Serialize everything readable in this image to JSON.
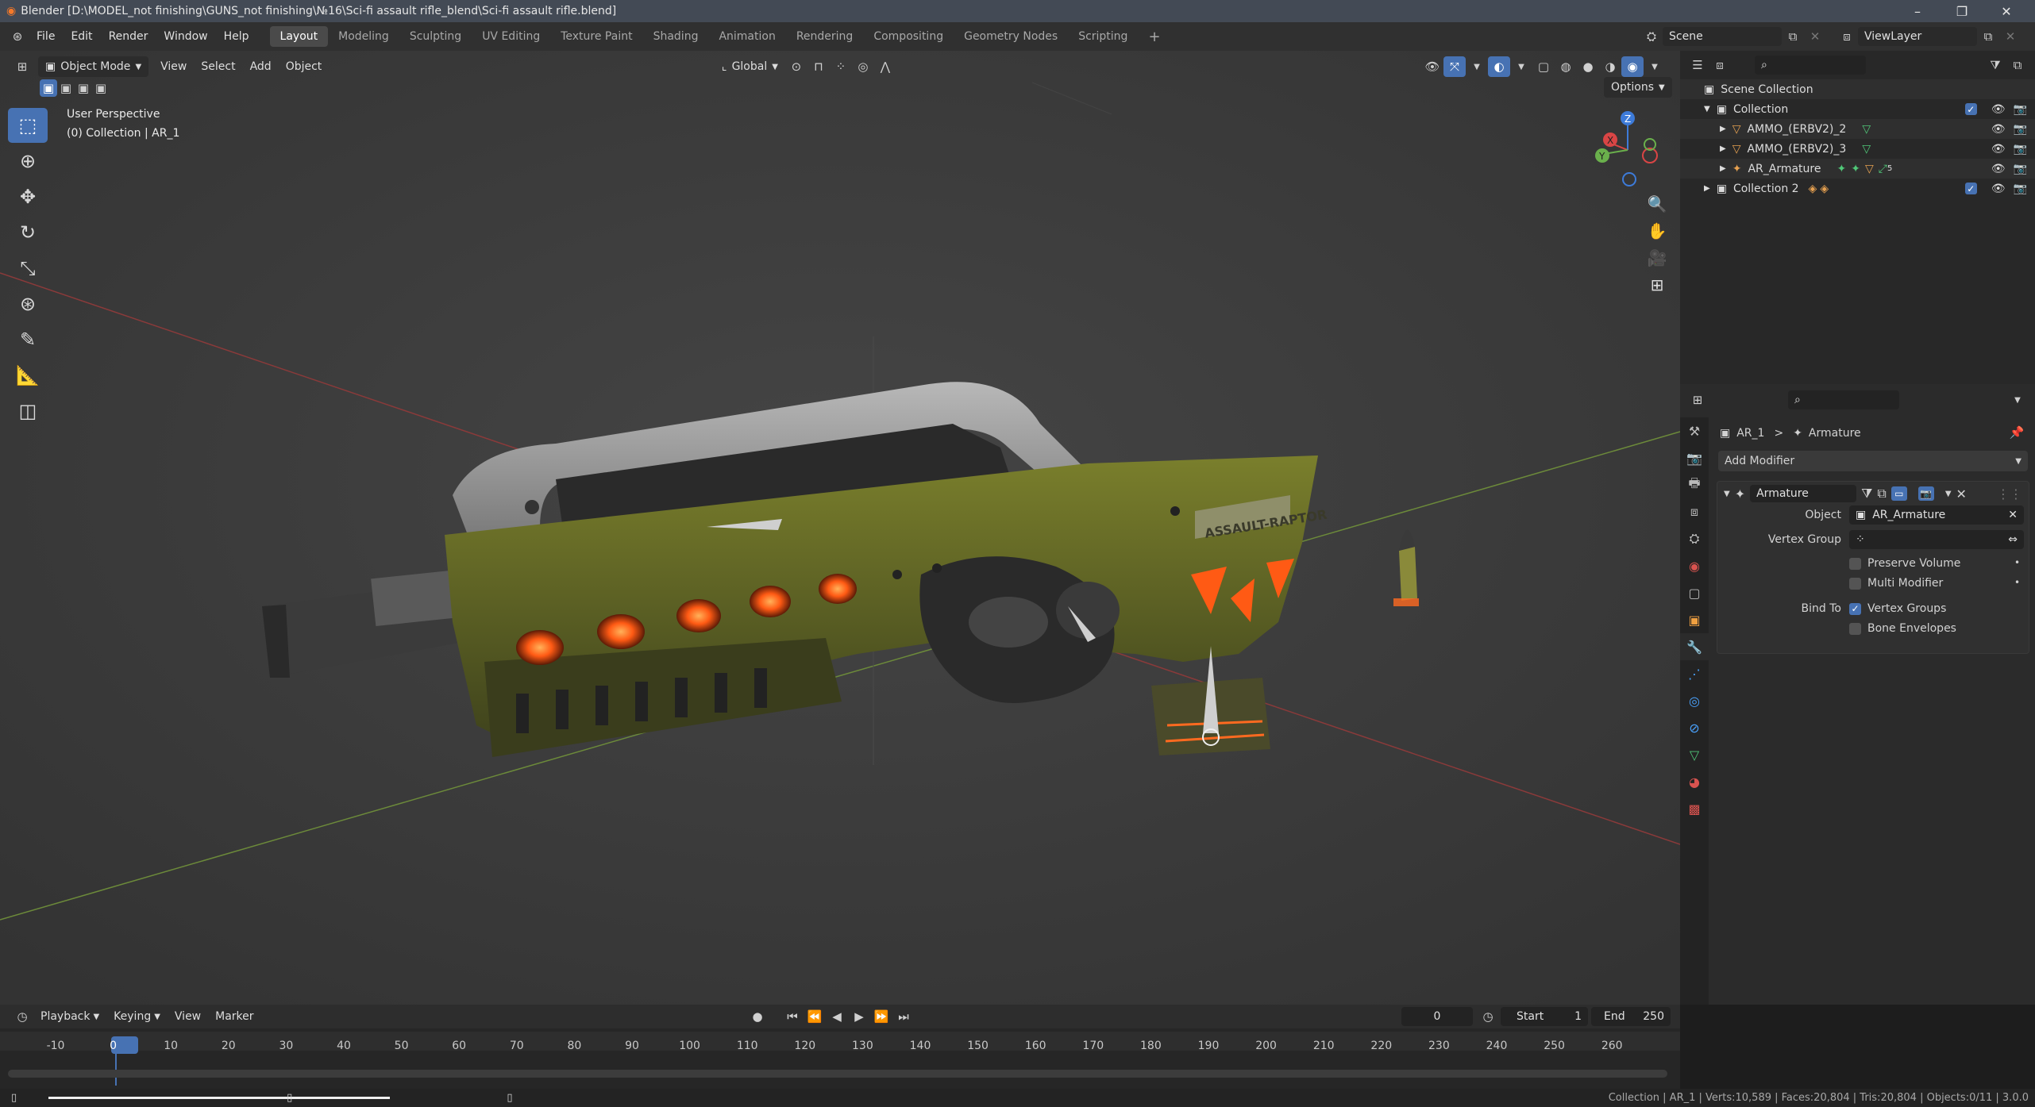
{
  "titlebar": {
    "title": "Blender [D:\\MODEL_not finishing\\GUNS_not finishing\\№16\\Sci-fi assault rifle_blend\\Sci-fi assault rifle.blend]",
    "minimize": "–",
    "maximize": "❐",
    "close": "✕"
  },
  "menubar": {
    "items": [
      "File",
      "Edit",
      "Render",
      "Window",
      "Help"
    ],
    "workspaces": [
      "Layout",
      "Modeling",
      "Sculpting",
      "UV Editing",
      "Texture Paint",
      "Shading",
      "Animation",
      "Rendering",
      "Compositing",
      "Geometry Nodes",
      "Scripting"
    ],
    "add_workspace": "+",
    "scene": "Scene",
    "view_layer": "ViewLayer"
  },
  "viewport": {
    "mode": "Object Mode",
    "menus": [
      "View",
      "Select",
      "Add",
      "Object"
    ],
    "transform_orientation": "Global",
    "options": "Options",
    "overlay_line1": "User Perspective",
    "overlay_line2": "(0) Collection | AR_1",
    "gizmo": {
      "x": "X",
      "y": "Y",
      "z": "Z"
    },
    "weapon_label": "ASSAULT-RAPTOR"
  },
  "outliner": {
    "search_placeholder": "",
    "root": "Scene Collection",
    "collection": "Collection",
    "children": [
      "AMMO_(ERBV2)_2",
      "AMMO_(ERBV2)_3",
      "AR_Armature"
    ],
    "armature_badge": "5",
    "collection2": "Collection 2"
  },
  "properties": {
    "breadcrumb_object": "AR_1",
    "breadcrumb_sep": ">",
    "breadcrumb_data": "Armature",
    "add_modifier": "Add Modifier",
    "modifier_name": "Armature",
    "object_label": "Object",
    "object_value": "AR_Armature",
    "vertex_group_label": "Vertex Group",
    "vertex_group_value": "",
    "preserve_volume": "Preserve Volume",
    "multi_modifier": "Multi Modifier",
    "bind_to_label": "Bind To",
    "vertex_groups": "Vertex Groups",
    "bone_envelopes": "Bone Envelopes"
  },
  "timeline": {
    "menus": [
      "Playback",
      "Keying",
      "View",
      "Marker"
    ],
    "current_frame": "0",
    "start_label": "Start",
    "start_value": "1",
    "end_label": "End",
    "end_value": "250",
    "ticks": [
      "-10",
      "0",
      "10",
      "20",
      "30",
      "40",
      "50",
      "60",
      "70",
      "80",
      "90",
      "100",
      "110",
      "120",
      "130",
      "140",
      "150",
      "160",
      "170",
      "180",
      "190",
      "200",
      "210",
      "220",
      "230",
      "240",
      "250",
      "260"
    ]
  },
  "statusbar": {
    "stats": "Collection | AR_1 | Verts:10,589 | Faces:20,804 | Tris:20,804 | Objects:0/11 | 3.0.0"
  }
}
